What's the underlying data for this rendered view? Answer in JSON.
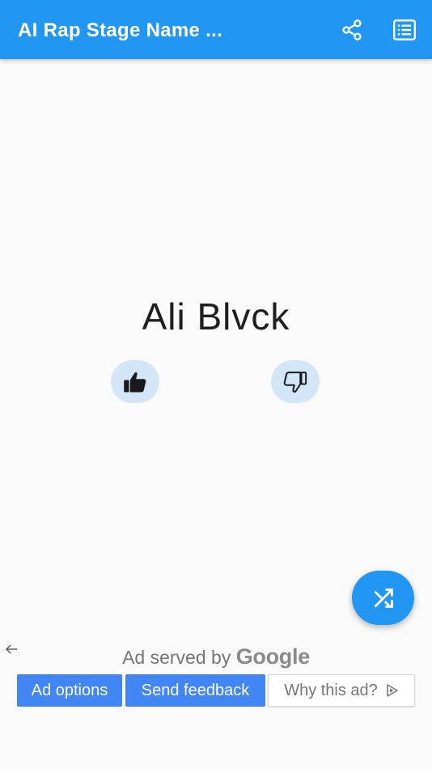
{
  "appbar": {
    "title": "AI Rap Stage Name ...",
    "share_icon": "share-icon",
    "list_icon": "list-icon",
    "color": "#2196f3"
  },
  "main": {
    "generated_name": "Ali Blvck",
    "like_icon": "thumbs-up-icon",
    "dislike_icon": "thumbs-down-icon",
    "shuffle_icon": "shuffle-icon"
  },
  "ad": {
    "back_icon": "arrow-left-icon",
    "served_by": "Ad served by",
    "brand": "Google",
    "ad_options": "Ad options",
    "send_feedback": "Send feedback",
    "why_this_ad": "Why this ad?",
    "why_icon": "adchoices-triangle-icon",
    "button_color": "#4285f4"
  }
}
